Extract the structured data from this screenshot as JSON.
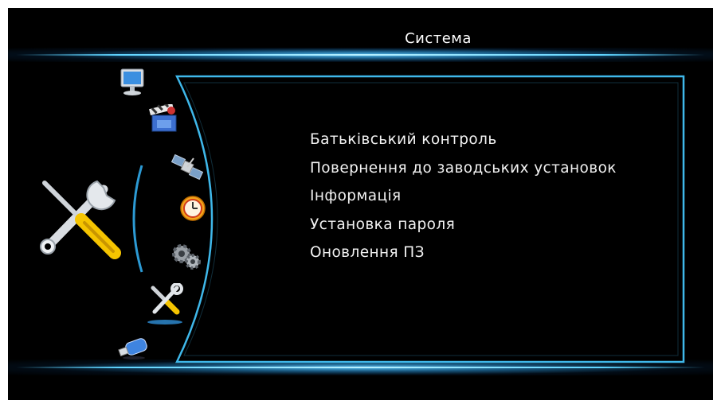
{
  "header": {
    "title": "Система"
  },
  "sidebar": {
    "items": [
      {
        "icon": "monitor-icon",
        "selected": false
      },
      {
        "icon": "film-clapper-icon",
        "selected": false
      },
      {
        "icon": "satellite-icon",
        "selected": false
      },
      {
        "icon": "clock-icon",
        "selected": false
      },
      {
        "icon": "gears-icon",
        "selected": false
      },
      {
        "icon": "tools-icon",
        "selected": true
      },
      {
        "icon": "usb-drive-icon",
        "selected": false
      }
    ],
    "large_icon": "tools-icon"
  },
  "menu": {
    "items": [
      {
        "label": "Батьківський контроль"
      },
      {
        "label": "Повернення до заводських установок"
      },
      {
        "label": "Інформація"
      },
      {
        "label": "Установка пароля"
      },
      {
        "label": "Оновлення ПЗ"
      }
    ]
  },
  "colors": {
    "background": "#000000",
    "accent_glow": "#5fd4ff",
    "text": "#f2f2f2",
    "tool_handle": "#f5c400"
  }
}
